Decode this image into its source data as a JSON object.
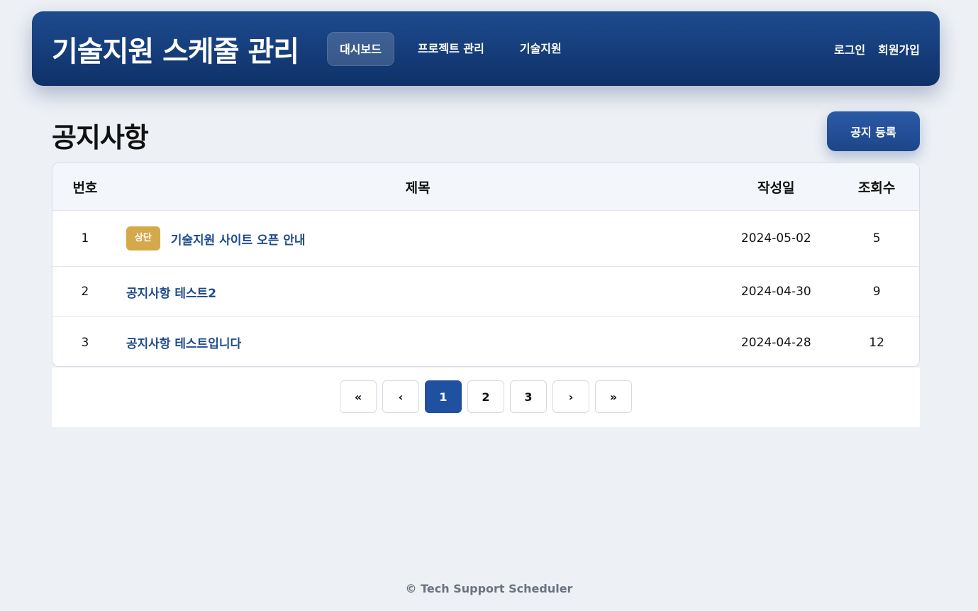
{
  "header": {
    "brand": "기술지원 스케줄 관리",
    "nav": [
      {
        "label": "대시보드",
        "active": true
      },
      {
        "label": "프로젝트 관리",
        "active": false
      },
      {
        "label": "기술지원",
        "active": false
      }
    ],
    "auth": {
      "login": "로그인",
      "signup": "회원가입"
    }
  },
  "page": {
    "title": "공지사항",
    "add_button": "공지 등록"
  },
  "table": {
    "columns": [
      "번호",
      "제목",
      "작성일",
      "조회수"
    ],
    "rows": [
      {
        "no": "1",
        "badge": "상단",
        "title": "기술지원 사이트 오픈 안내",
        "date": "2024-05-02",
        "views": "5"
      },
      {
        "no": "2",
        "badge": "",
        "title": "공지사항 테스트2",
        "date": "2024-04-30",
        "views": "9"
      },
      {
        "no": "3",
        "badge": "",
        "title": "공지사항 테스트입니다",
        "date": "2024-04-28",
        "views": "12"
      }
    ]
  },
  "pagination": {
    "first": "«",
    "prev": "‹",
    "pages": [
      "1",
      "2",
      "3"
    ],
    "current": "1",
    "next": "›",
    "last": "»"
  },
  "footer": {
    "text": "© Tech Support Scheduler"
  },
  "colors": {
    "header": "#1d4b8f",
    "accent": "#2051a0",
    "badge": "#d4a94a",
    "link": "#1d4b8f"
  }
}
